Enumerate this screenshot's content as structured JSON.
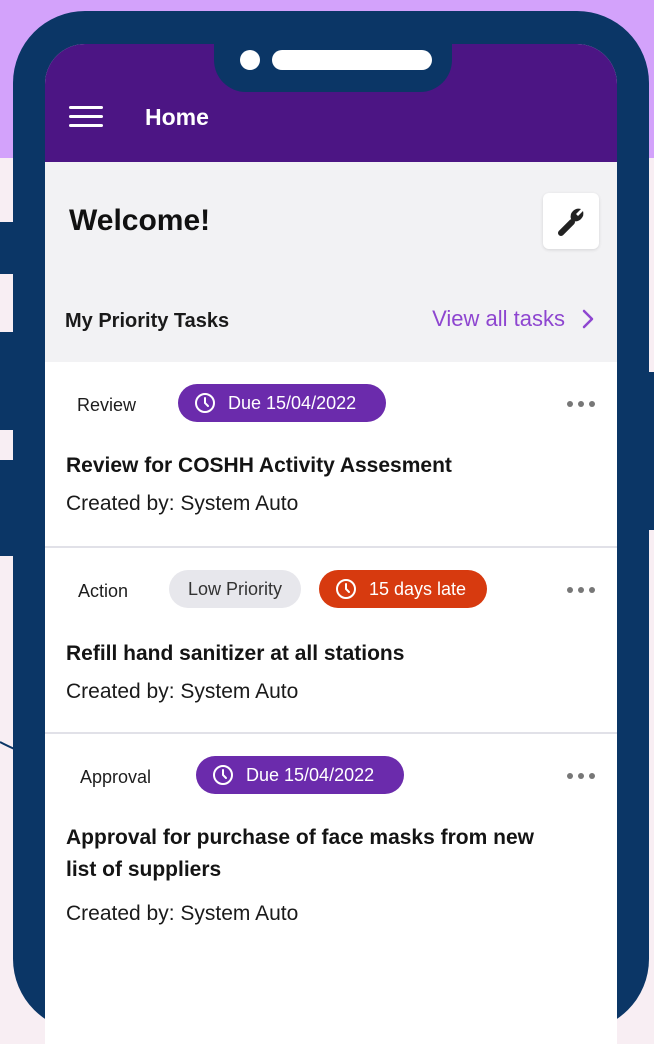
{
  "app_bar": {
    "title": "Home"
  },
  "welcome": {
    "text": "Welcome!"
  },
  "priority": {
    "section_title": "My Priority Tasks",
    "view_all_label": "View all tasks"
  },
  "tasks": [
    {
      "type": "Review",
      "due_label": "Due 15/04/2022",
      "title": "Review for COSHH Activity Assesment",
      "created_by": "Created by: System Auto"
    },
    {
      "type": "Action",
      "priority_label": "Low Priority",
      "late_label": "15 days late",
      "title": "Refill hand sanitizer at all stations",
      "created_by": "Created by: System Auto"
    },
    {
      "type": "Approval",
      "due_label": "Due 15/04/2022",
      "title": "Approval for purchase of face masks from new list of suppliers",
      "created_by": "Created by: System Auto"
    }
  ],
  "colors": {
    "app_bar": "#4c1584",
    "accent": "#8e46d0",
    "due_chip": "#6b2bac",
    "late_chip": "#d73a0f",
    "phone_frame": "#0b3666",
    "background_top": "#d3a2fb"
  },
  "icons": {
    "menu": "hamburger-icon",
    "tool": "wrench-icon",
    "view_all": "chevron-right-icon",
    "due": "clock-icon",
    "more": "more-horizontal-icon"
  }
}
